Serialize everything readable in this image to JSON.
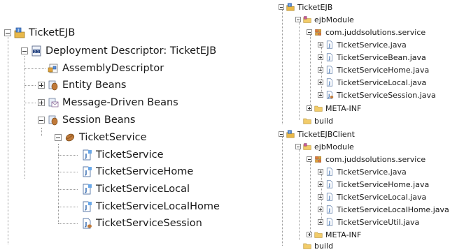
{
  "left_tree": {
    "root": "TicketEJB",
    "deployment": "Deployment Descriptor: TicketEJB",
    "assembly": "AssemblyDescriptor",
    "entity": "Entity Beans",
    "mdb": "Message-Driven Beans",
    "session": "Session Beans",
    "service": "TicketService",
    "children": [
      "TicketService",
      "TicketServiceHome",
      "TicketServiceLocal",
      "TicketServiceLocalHome",
      "TicketServiceSession"
    ]
  },
  "right_tree": {
    "project1": {
      "name": "TicketEJB",
      "module": "ejbModule",
      "package": "com.juddsolutions.service",
      "files": [
        "TicketService.java",
        "TicketServiceBean.java",
        "TicketServiceHome.java",
        "TicketServiceLocal.java",
        "TicketServiceSession.java"
      ],
      "meta": "META-INF",
      "build": "build"
    },
    "project2": {
      "name": "TicketEJBClient",
      "module": "ejbModule",
      "package": "com.juddsolutions.service",
      "files": [
        "TicketService.java",
        "TicketServiceHome.java",
        "TicketServiceLocal.java",
        "TicketServiceLocalHome.java",
        "TicketServiceUtil.java"
      ],
      "meta": "META-INF",
      "build": "build"
    }
  },
  "colors": {
    "folder": "#e8b84a",
    "java": "#3a6fb3",
    "bean": "#b06a2a"
  }
}
